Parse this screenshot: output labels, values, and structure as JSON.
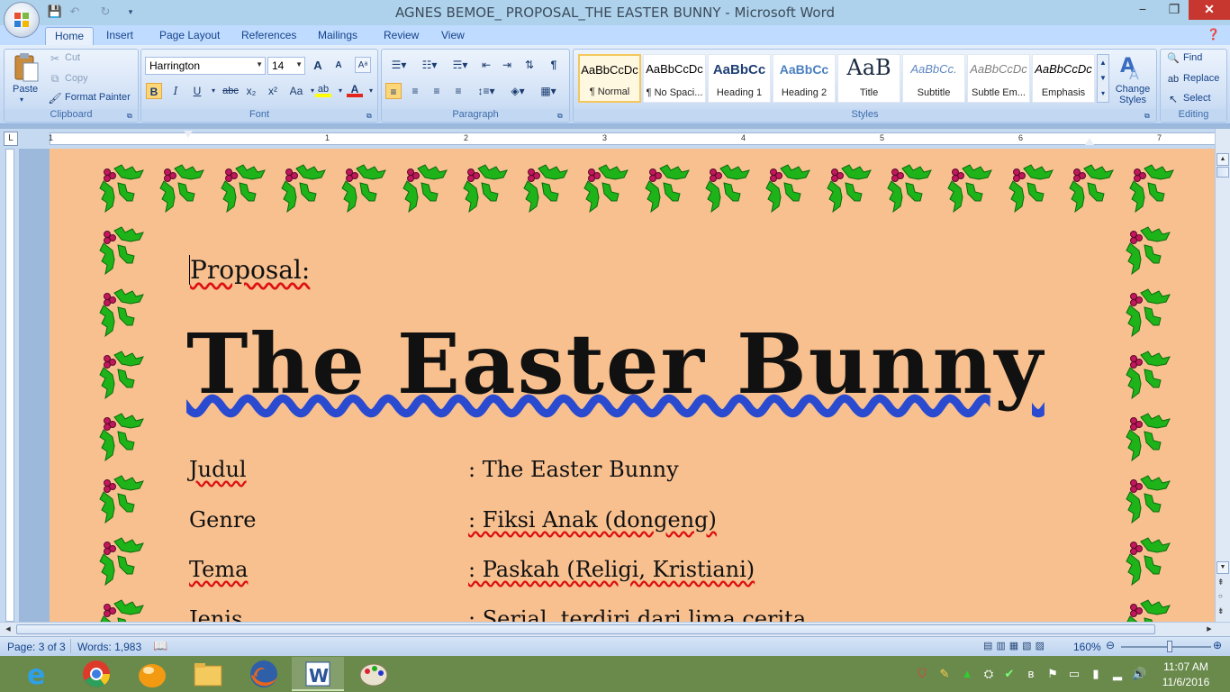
{
  "window": {
    "title": "AGNES BEMOE_ PROPOSAL_THE EASTER BUNNY - Microsoft Word",
    "minimize": "−",
    "restore": "❐",
    "close": "✕"
  },
  "tabs": [
    "Home",
    "Insert",
    "Page Layout",
    "References",
    "Mailings",
    "Review",
    "View"
  ],
  "clipboard": {
    "paste": "Paste",
    "cut": "Cut",
    "copy": "Copy",
    "format_painter": "Format Painter",
    "label": "Clipboard"
  },
  "font": {
    "family": "Harrington",
    "size": "14",
    "label": "Font",
    "bold": "B",
    "italic": "I",
    "underline": "U",
    "strike": "abc",
    "subscript": "x₂",
    "superscript": "x²",
    "change_case": "Aa",
    "grow": "A",
    "shrink": "A"
  },
  "paragraph": {
    "label": "Paragraph",
    "show_marks": "¶"
  },
  "styles": {
    "label": "Styles",
    "items": [
      {
        "preview": "AaBbCcDc",
        "name": "¶ Normal"
      },
      {
        "preview": "AaBbCcDc",
        "name": "¶ No Spaci..."
      },
      {
        "preview": "AaBbCc",
        "name": "Heading 1"
      },
      {
        "preview": "AaBbCc",
        "name": "Heading 2"
      },
      {
        "preview": "AaB",
        "name": "Title"
      },
      {
        "preview": "AaBbCc.",
        "name": "Subtitle"
      },
      {
        "preview": "AaBbCcDc",
        "name": "Subtle Em..."
      },
      {
        "preview": "AaBbCcDc",
        "name": "Emphasis"
      }
    ],
    "change_styles": "Change Styles"
  },
  "editing": {
    "label": "Editing",
    "find": "Find",
    "replace": "Replace",
    "select": "Select"
  },
  "ruler_numbers": [
    "1",
    "1",
    "2",
    "3",
    "4",
    "5",
    "6",
    "7"
  ],
  "document": {
    "heading": "Proposal:",
    "title": "The Easter Bunny",
    "rows": [
      {
        "label": "Judul",
        "value": ": The Easter Bunny"
      },
      {
        "label": "Genre",
        "value": ": Fiksi Anak (dongeng)"
      },
      {
        "label": "Tema",
        "value": ": Paskah (Religi, Kristiani)"
      },
      {
        "label": "Jenis",
        "value": ": Serial, terdiri dari lima cerita"
      }
    ]
  },
  "statusbar": {
    "page": "Page: 3 of 3",
    "words": "Words: 1,983",
    "zoom": "160%"
  },
  "taskbar": {
    "time": "11:07 AM",
    "date": "11/6/2016"
  },
  "colors": {
    "page_bg": "#f8c08f",
    "ribbon_bg": "#c9dcf4",
    "taskbar_bg": "#6a8a4c",
    "holly_green": "#1fb31a",
    "berry": "#c2185b"
  }
}
